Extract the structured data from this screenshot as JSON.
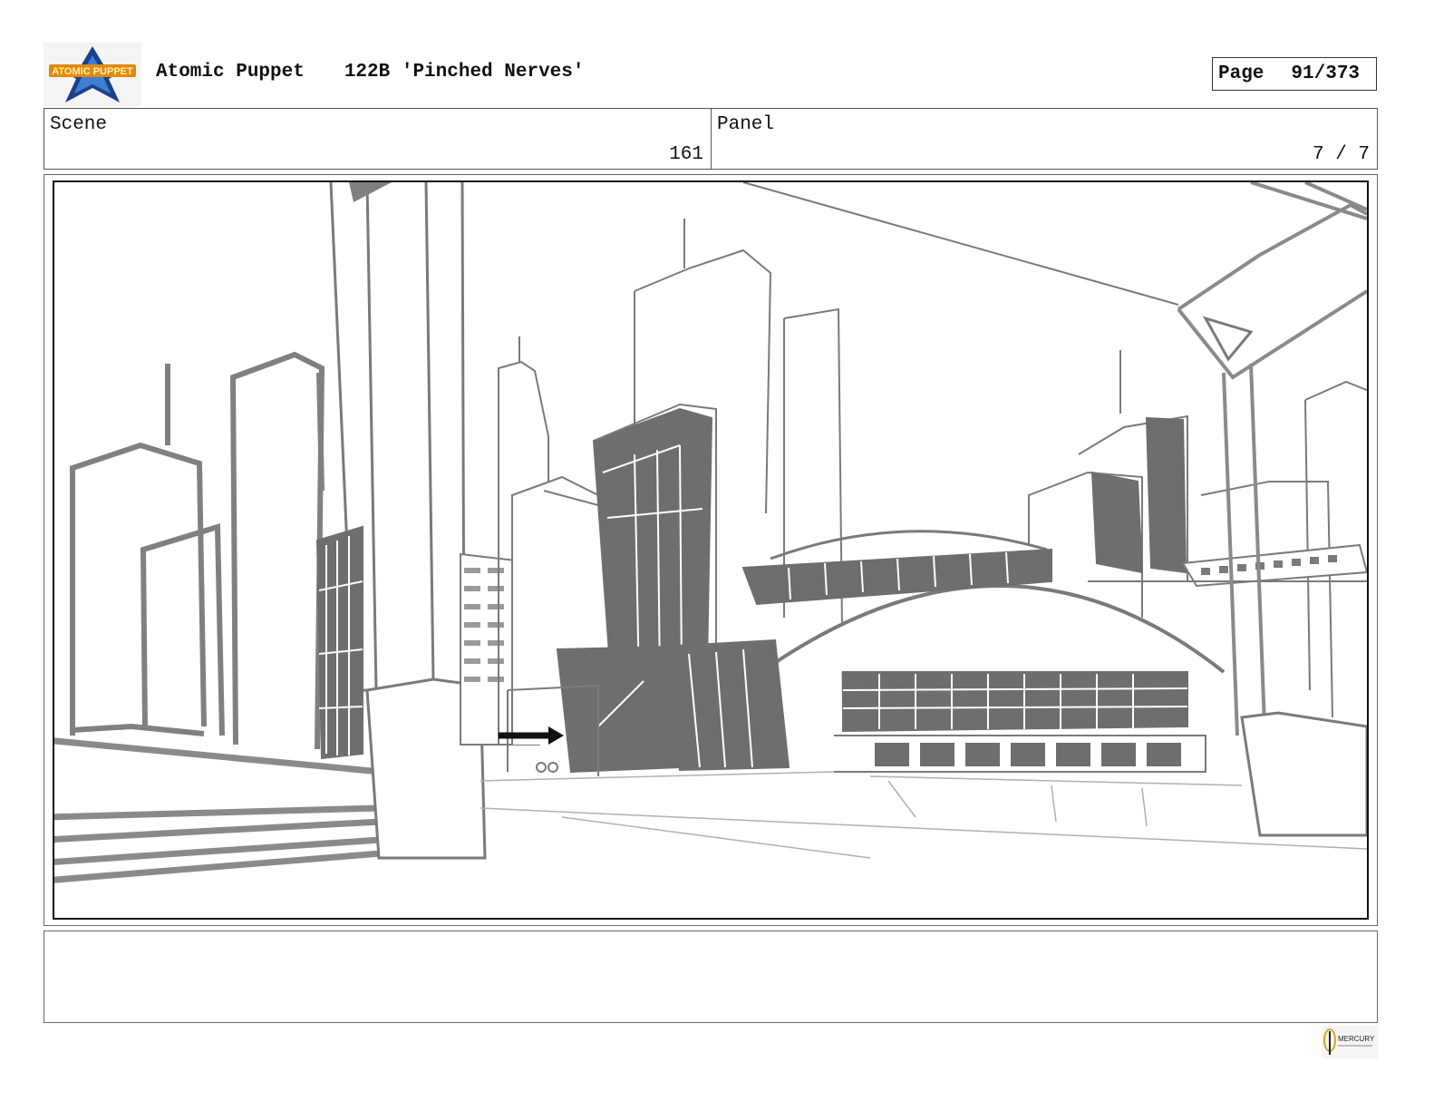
{
  "header": {
    "show_title": "Atomic Puppet",
    "episode": "122B 'Pinched Nerves'",
    "page_label": "Page",
    "page_number": "91/373",
    "logo_text": "ATOMIC PUPPET"
  },
  "scene": {
    "label": "Scene",
    "value": "161"
  },
  "panel": {
    "label": "Panel",
    "value": "7 / 7"
  },
  "notes": {
    "text": ""
  },
  "footer": {
    "studio_logo_text": "MERCURY"
  }
}
